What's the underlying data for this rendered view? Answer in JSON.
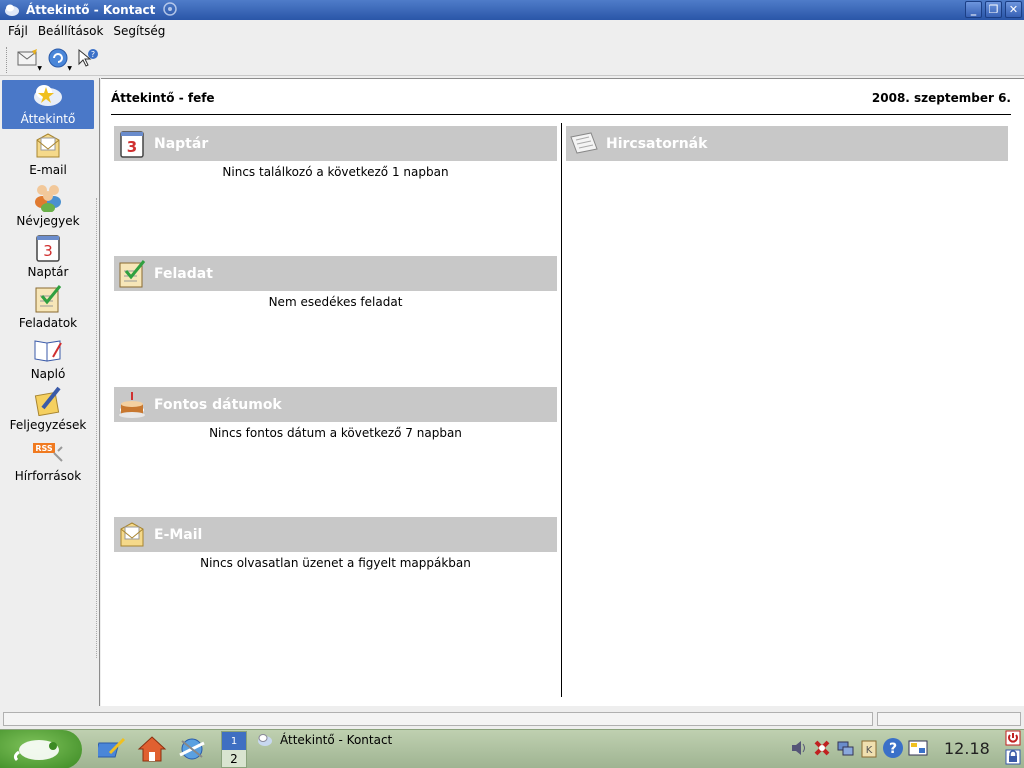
{
  "window": {
    "title": "Áttekintő - Kontact",
    "buttons": {
      "minimize": "_",
      "maximize": "❐",
      "close": "✕"
    }
  },
  "menubar": {
    "items": [
      {
        "label": "Fájl"
      },
      {
        "label": "Beállítások"
      },
      {
        "label": "Segítség"
      }
    ]
  },
  "toolbar": {
    "buttons": [
      {
        "icon": "new-mail-icon"
      },
      {
        "icon": "sync-icon"
      },
      {
        "icon": "whats-this-icon"
      }
    ]
  },
  "sidebar": {
    "items": [
      {
        "label": "Áttekintő",
        "icon": "overview-icon",
        "active": true
      },
      {
        "label": "E-mail",
        "icon": "mail-icon"
      },
      {
        "label": "Névjegyek",
        "icon": "contacts-icon"
      },
      {
        "label": "Naptár",
        "icon": "calendar-icon"
      },
      {
        "label": "Feladatok",
        "icon": "tasks-icon"
      },
      {
        "label": "Napló",
        "icon": "journal-icon"
      },
      {
        "label": "Feljegyzések",
        "icon": "notes-icon"
      },
      {
        "label": "Hírforrások",
        "icon": "rss-icon"
      }
    ]
  },
  "main": {
    "header": {
      "title": "Áttekintő - fefe",
      "date": "2008. szeptember 6."
    },
    "left_sections": [
      {
        "title": "Naptár",
        "icon": "calendar-icon",
        "text": "Nincs találkozó a következő 1 napban"
      },
      {
        "title": "Feladat",
        "icon": "tasks-icon",
        "text": "Nem esedékes feladat"
      },
      {
        "title": "Fontos dátumok",
        "icon": "cake-icon",
        "text": "Nincs fontos dátum a következő 7 napban"
      },
      {
        "title": "E-Mail",
        "icon": "mail-icon",
        "text": "Nincs olvasatlan üzenet a figyelt mappákban"
      }
    ],
    "right_sections": [
      {
        "title": "Hircsatornák",
        "icon": "newspaper-icon"
      }
    ]
  },
  "taskbar": {
    "pager": {
      "desktop1": "1",
      "desktop2": "2"
    },
    "task": {
      "label": "Áttekintő - Kontact"
    },
    "clock": "12.18"
  },
  "colors": {
    "titlebar": "#2a56a8",
    "active_nav": "#4a78c8",
    "section_header": "#c8c8c8",
    "taskbar": "#9fb492"
  }
}
